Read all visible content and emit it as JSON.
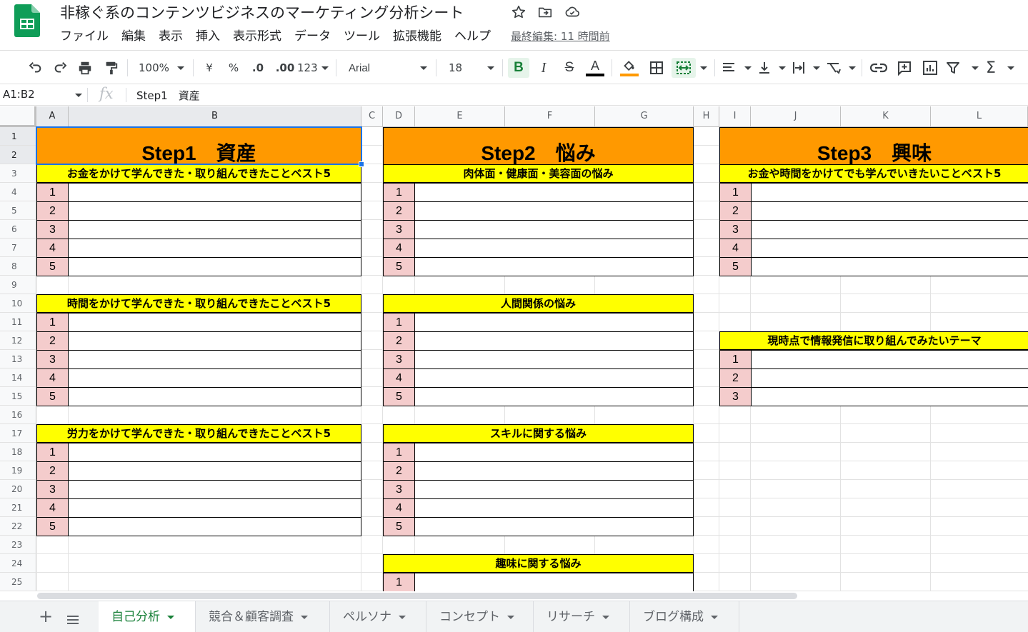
{
  "document": {
    "title": "非稼ぐ系のコンテンツビジネスのマーケティング分析シート",
    "last_edit": "最終編集: 11 時間前"
  },
  "menu": [
    "ファイル",
    "編集",
    "表示",
    "挿入",
    "表示形式",
    "データ",
    "ツール",
    "拡張機能",
    "ヘルプ"
  ],
  "toolbar": {
    "zoom": "100%",
    "currency": "¥",
    "percent": "%",
    "decimal_decrease": ".0",
    "decimal_increase": ".00",
    "number_format": "123",
    "font": "Arial",
    "font_size": "18",
    "bold": "B",
    "italic": "I",
    "strikethrough": "S",
    "text_color_label": "A",
    "text_color": "#000000",
    "fill_color": "#ff9900",
    "sum": "Σ"
  },
  "formula_bar": {
    "name_box": "A1:B2",
    "fx": "fx",
    "value": "Step1　資産"
  },
  "grid": {
    "columns": [
      "A",
      "B",
      "C",
      "D",
      "E",
      "F",
      "G",
      "H",
      "I",
      "J",
      "K",
      "L"
    ],
    "rows": [
      "1",
      "2",
      "3",
      "4",
      "5",
      "6",
      "7",
      "8",
      "9",
      "10",
      "11",
      "12",
      "13",
      "14",
      "15",
      "16",
      "17",
      "18",
      "19",
      "20",
      "21",
      "22",
      "23",
      "24",
      "25"
    ],
    "header_color": "#ff9900",
    "section_color": "#ffff00",
    "number_color": "#f4cccc"
  },
  "steps": [
    {
      "title": "Step1　資産",
      "sections": [
        {
          "title": "お金をかけて学んできた・取り組んできたことベスト5",
          "items": [
            "1",
            "2",
            "3",
            "4",
            "5"
          ]
        },
        {
          "title": "時間をかけて学んできた・取り組んできたことベスト5",
          "items": [
            "1",
            "2",
            "3",
            "4",
            "5"
          ]
        },
        {
          "title": "労力をかけて学んできた・取り組んできたことベスト5",
          "items": [
            "1",
            "2",
            "3",
            "4",
            "5"
          ]
        }
      ]
    },
    {
      "title": "Step2　悩み",
      "sections": [
        {
          "title": "肉体面・健康面・美容面の悩み",
          "items": [
            "1",
            "2",
            "3",
            "4",
            "5"
          ]
        },
        {
          "title": "人間関係の悩み",
          "items": [
            "1",
            "2",
            "3",
            "4",
            "5"
          ]
        },
        {
          "title": "スキルに関する悩み",
          "items": [
            "1",
            "2",
            "3",
            "4",
            "5"
          ]
        },
        {
          "title": "趣味に関する悩み",
          "items": [
            "1"
          ]
        }
      ]
    },
    {
      "title": "Step3　興味",
      "sections": [
        {
          "title": "お金や時間をかけてでも学んでいきたいことベスト5",
          "items": [
            "1",
            "2",
            "3",
            "4",
            "5"
          ]
        },
        {
          "title": "現時点で情報発信に取り組んでみたいテーマ",
          "items": [
            "1",
            "2",
            "3"
          ]
        }
      ]
    }
  ],
  "sheet_tabs": [
    {
      "label": "自己分析",
      "active": true
    },
    {
      "label": "競合＆顧客調査",
      "active": false
    },
    {
      "label": "ペルソナ",
      "active": false
    },
    {
      "label": "コンセプト",
      "active": false
    },
    {
      "label": "リサーチ",
      "active": false
    },
    {
      "label": "ブログ構成",
      "active": false
    }
  ],
  "icons": {
    "logo": "sheets-logo-icon",
    "star": "star-icon",
    "move": "move-to-folder-icon",
    "cloud": "cloud-status-icon"
  }
}
